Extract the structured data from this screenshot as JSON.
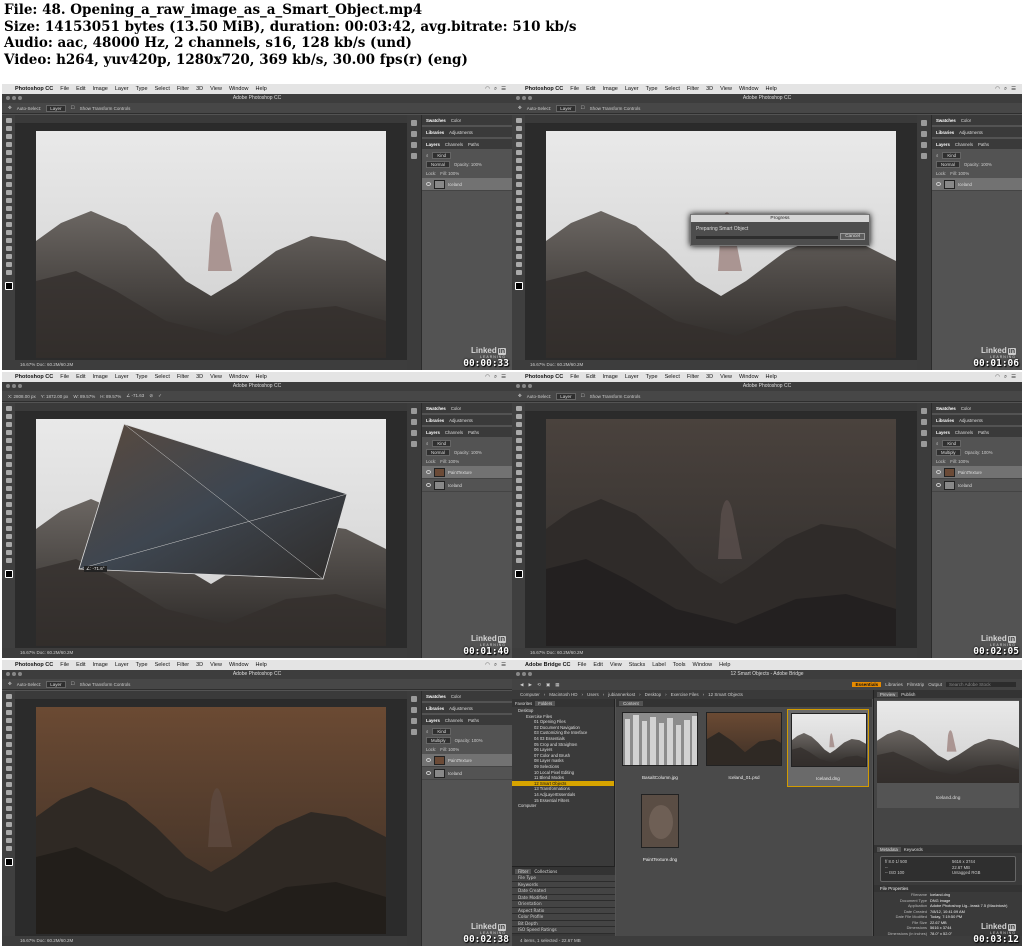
{
  "header": {
    "file": "File: 48. Opening_a_raw_image_as_a_Smart_Object.mp4",
    "size": "Size: 14153051 bytes (13.50 MiB), duration: 00:03:42, avg.bitrate: 510 kb/s",
    "audio": "Audio: aac, 48000 Hz, 2 channels, s16, 128 kb/s (und)",
    "video": "Video: h264, yuv420p, 1280x720, 369 kb/s, 30.00 fps(r) (eng)"
  },
  "ps": {
    "menu": [
      "Photoshop CC",
      "File",
      "Edit",
      "Image",
      "Layer",
      "Type",
      "Select",
      "Filter",
      "3D",
      "View",
      "Window",
      "Help"
    ],
    "window_title": "Adobe Photoshop CC",
    "options_auto_select": "Auto-Select:",
    "options_layer": "Layer",
    "options_transform": "Show Transform Controls",
    "doc_tab_iceland": "© Iceland-9 @ 16.7% (Iceland, RGB/8*) *",
    "doc_tab_texture": "© Iceland-9 @ 16.7% (PaintTexture, RGB/8*) *",
    "status": "16.67%     Doc: 60.2M/60.2M",
    "panel_tabs_top": [
      "Swatches",
      "Color"
    ],
    "panel_tabs_mid": [
      "Libraries",
      "Adjustments"
    ],
    "panel_tabs_layers": [
      "Layers",
      "Channels",
      "Paths"
    ],
    "kind": "Kind",
    "blend_normal": "Normal",
    "blend_multiply": "Multiply",
    "opacity": "Opacity: 100%",
    "lock": "Lock:",
    "fill": "Fill: 100%",
    "layer_iceland": "Iceland",
    "layer_texture": "PaintTexture",
    "transform_values": [
      "X: 2808.00 px",
      "Y: 1872.00 px",
      "W: 89.57%",
      "H: 89.57%",
      "∠ -71.63"
    ],
    "angle_tooltip": "∠: -71.6°"
  },
  "progress": {
    "title": "Progress",
    "message": "Preparing Smart Object",
    "cancel": "Cancel"
  },
  "watermark": {
    "name": "Linked",
    "in": "in",
    "sub": "LEARNING"
  },
  "timestamps": [
    "00:00:33",
    "00:01:06",
    "00:01:40",
    "00:02:05",
    "00:02:38",
    "00:03:12"
  ],
  "bridge": {
    "menu": [
      "Adobe Bridge CC",
      "File",
      "Edit",
      "View",
      "Stacks",
      "Label",
      "Tools",
      "Window",
      "Help"
    ],
    "window_title": "12 Smart Objects - Adobe Bridge",
    "workspaces": [
      "Essentials",
      "Libraries",
      "Filmstrip",
      "Output"
    ],
    "search_placeholder": "Search Adobe Stock",
    "path": [
      "Computer",
      "Macintosh HD",
      "Users",
      "jubiannerkost",
      "Desktop",
      "Exercise Files",
      "12 Smart Objects"
    ],
    "left_tabs": [
      "Favorites",
      "Folders"
    ],
    "tree": [
      {
        "label": "Desktop",
        "level": 1
      },
      {
        "label": "Exercise Files",
        "level": 2
      },
      {
        "label": "01 Opening Files",
        "level": 3
      },
      {
        "label": "02 Document Navigation",
        "level": 3
      },
      {
        "label": "03 Customizing the Interface",
        "level": 3
      },
      {
        "label": "04 03 Essentials",
        "level": 3
      },
      {
        "label": "05 Crop and Straighten",
        "level": 3
      },
      {
        "label": "06 Layers",
        "level": 3
      },
      {
        "label": "07 Color and Brush",
        "level": 3
      },
      {
        "label": "08 Layer masks",
        "level": 3
      },
      {
        "label": "09 Selections",
        "level": 3
      },
      {
        "label": "10 Local Pixel Editing",
        "level": 3
      },
      {
        "label": "11 Blend Modes",
        "level": 3
      },
      {
        "label": "12 Smart Objects",
        "level": 3,
        "selected": true
      },
      {
        "label": "13 Transformations",
        "level": 3
      },
      {
        "label": "14 AdjLayerEssentials",
        "level": 3
      },
      {
        "label": "15 Essential Filters",
        "level": 3
      },
      {
        "label": "Computer",
        "level": 1
      }
    ],
    "filter_tabs": [
      "Filter",
      "Collections"
    ],
    "filters": [
      "File Type",
      "Keywords",
      "Date Created",
      "Date Modified",
      "Orientation",
      "Aspect Ratio",
      "Color Profile",
      "Bit Depth",
      "ISO Speed Ratings"
    ],
    "content_tab": "Content",
    "thumbs": [
      "BasaltColumn.jpg",
      "Iceland_01.psd",
      "Iceland.dng",
      "PaintTexture.dng"
    ],
    "preview_tabs": [
      "Preview",
      "Publish"
    ],
    "preview_label": "Iceland.dng",
    "meta_tabs": [
      "Metadata",
      "Keywords"
    ],
    "cam_left": [
      "f/ 8.0   1/ 500",
      "--",
      "--   ISO 100"
    ],
    "cam_right": [
      "5616 x 3744",
      "22.67 MB",
      "--",
      "Untagged   RGB"
    ],
    "fp_header": "File Properties",
    "file_properties": [
      {
        "k": "Filename",
        "v": "Iceland.dng"
      },
      {
        "k": "Document Type",
        "v": "DNG image"
      },
      {
        "k": "Application",
        "v": "Adobe Photoshop Lig...leask 7.5 (Macintosh)"
      },
      {
        "k": "Date Created",
        "v": "7/8/12, 10:41:09 AM"
      },
      {
        "k": "Date File Modified",
        "v": "Today, 7:19:50 PM"
      },
      {
        "k": "File Size",
        "v": "22.67 MB"
      },
      {
        "k": "Dimensions",
        "v": "5616 x 3744"
      },
      {
        "k": "Dimensions (in inches)",
        "v": "78.0\" x 52.0\""
      },
      {
        "k": "Bit Depth",
        "v": "16"
      }
    ],
    "status": "4 items, 1 selected - 22.67 MB"
  }
}
